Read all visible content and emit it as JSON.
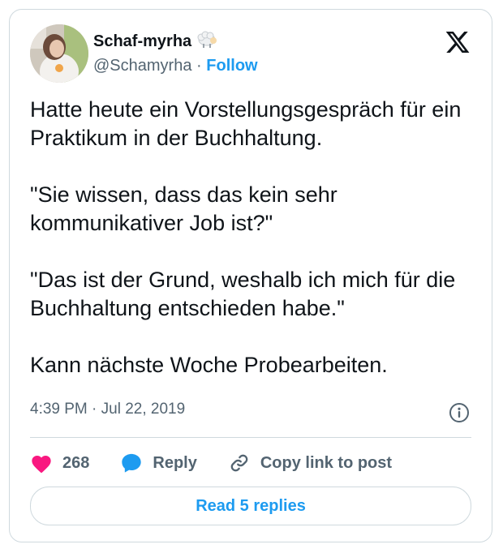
{
  "author": {
    "display_name": "Schaf-myrha",
    "name_emoji_icon": "sheep-emoji",
    "handle": "@Schamyrha",
    "separator": "·",
    "follow_label": "Follow"
  },
  "tweet": {
    "paragraphs": [
      "Hatte heute ein Vorstellungsgespräch für ein Praktikum in der Buchhaltung.",
      "\"Sie wissen, dass das kein sehr kommunikativer Job ist?\"",
      "\"Das ist der Grund, weshalb ich mich für die Buchhaltung entschieden habe.\"",
      "Kann nächste Woche Probearbeiten."
    ],
    "time": "4:39 PM",
    "date_separator": "·",
    "date": "Jul 22, 2019"
  },
  "actions": {
    "like_count": "268",
    "reply_label": "Reply",
    "copy_label": "Copy link to post"
  },
  "read_replies_label": "Read 5 replies",
  "colors": {
    "accent": "#1d9bf0",
    "like": "#f91880",
    "muted": "#536471",
    "border": "#cfd9de"
  }
}
